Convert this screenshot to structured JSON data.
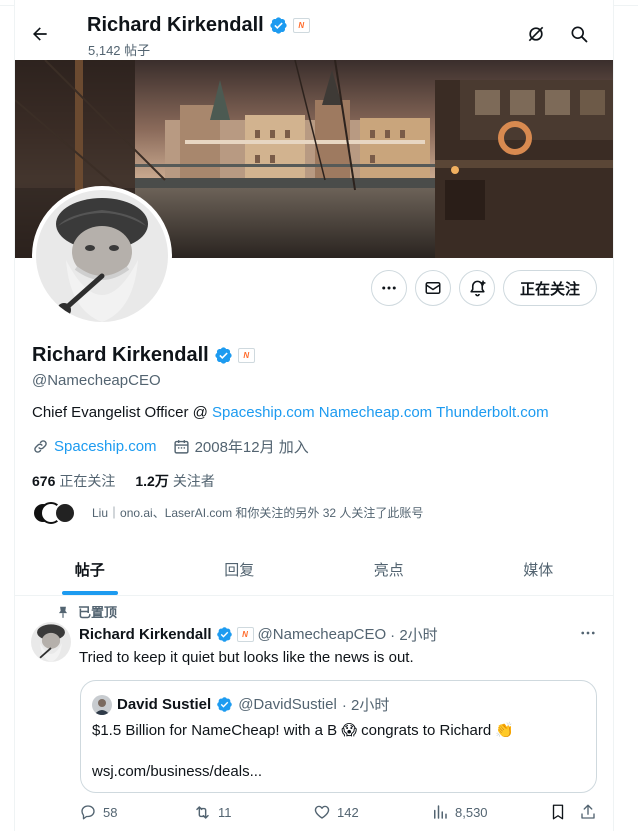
{
  "header": {
    "name": "Richard Kirkendall",
    "post_count": "5,142 帖子",
    "affiliate_badge": "N",
    "icons": [
      "back-arrow-icon",
      "grok-icon",
      "search-icon"
    ]
  },
  "profile": {
    "name": "Richard Kirkendall",
    "handle": "@NamecheapCEO",
    "bio_prefix": "Chief Evangelist Officer @ ",
    "bio_links": [
      "Spaceship.com",
      "Namecheap.com",
      "Thunderbolt.com"
    ],
    "website": "Spaceship.com",
    "joined": "2008年12月 加入",
    "following_count": "676",
    "following_label": "正在关注",
    "followers_count": "1.2万",
    "followers_label": "关注者",
    "followed_by": "Liu｜ono.ai、LaserAI.com 和你关注的另外 32 人关注了此账号",
    "follow_button": "正在关注"
  },
  "tabs": [
    "帖子",
    "回复",
    "亮点",
    "媒体"
  ],
  "active_tab": 0,
  "tweet": {
    "pinned_label": "已置顶",
    "author": "Richard Kirkendall",
    "handle": "@NamecheapCEO",
    "time": "· 2小时",
    "text": "Tried to keep it quiet but looks like the news is out.",
    "quote": {
      "author": "David Sustiel",
      "handle": "@DavidSustiel",
      "time": "· 2小时",
      "text_a": "$1.5 Billion for NameCheap! with a B ",
      "emoji_1": "😱",
      "text_b": " congrats to Richard ",
      "emoji_2": "👏",
      "link": "wsj.com/business/deals..."
    },
    "replies": "58",
    "retweets": "11",
    "likes": "142",
    "views": "8,530"
  },
  "colors": {
    "accent": "#1d9bf0",
    "text": "#0f1419",
    "secondary": "#536471",
    "border": "#cfd9de"
  }
}
